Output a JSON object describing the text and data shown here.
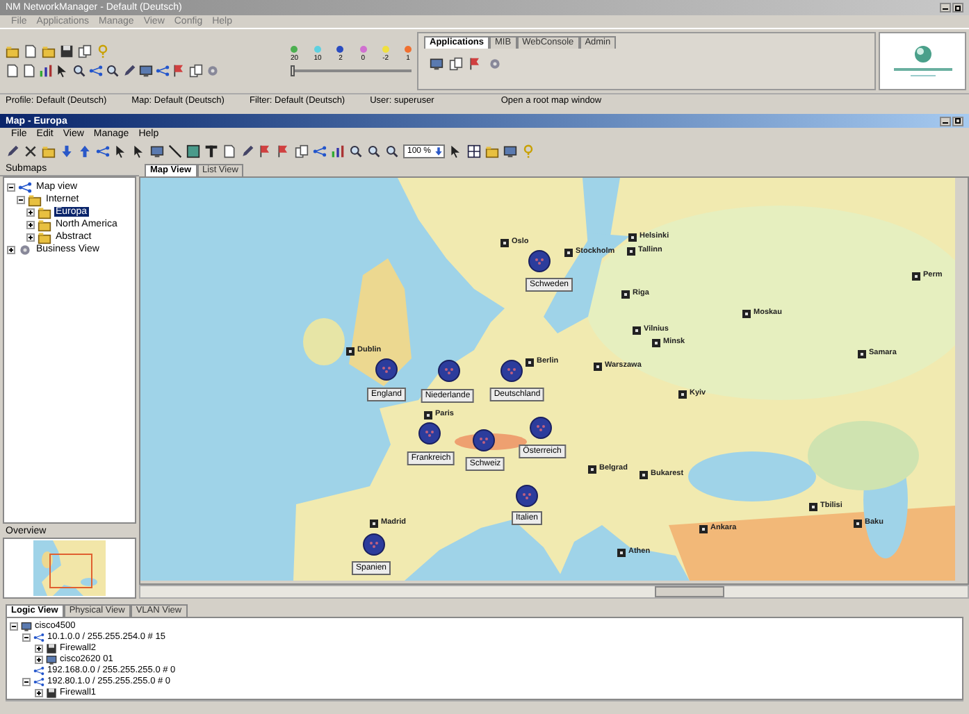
{
  "window": {
    "title": "NM NetworkManager - Default (Deutsch)"
  },
  "menu": [
    "File",
    "Applications",
    "Manage",
    "View",
    "Config",
    "Help"
  ],
  "legend": [
    {
      "color": "#4caf50",
      "label": "20"
    },
    {
      "color": "#5ed0e0",
      "label": "10"
    },
    {
      "color": "#2a4cc0",
      "label": "2"
    },
    {
      "color": "#d070d0",
      "label": "0"
    },
    {
      "color": "#f0e040",
      "label": "-2"
    },
    {
      "color": "#f07030",
      "label": "1"
    }
  ],
  "app_tabs": [
    {
      "label": "Applications",
      "selected": true
    },
    {
      "label": "MIB",
      "selected": false
    },
    {
      "label": "WebConsole",
      "selected": false
    },
    {
      "label": "Admin",
      "selected": false
    }
  ],
  "context": [
    "Profile: Default (Deutsch)",
    "Map: Default (Deutsch)",
    "Filter: Default (Deutsch)",
    "User: superuser",
    "Open a root map window"
  ],
  "map_window": {
    "title": "Map - Europa",
    "menu": [
      "File",
      "Edit",
      "View",
      "Manage",
      "Help"
    ],
    "zoom": "100 %"
  },
  "submaps": {
    "title": "Submaps",
    "tree": [
      {
        "label": "Map view",
        "expanded": true,
        "selected": false,
        "children": [
          {
            "label": "Internet",
            "expanded": true,
            "selected": false,
            "children": [
              {
                "label": "Europa",
                "expanded": false,
                "selected": true
              },
              {
                "label": "North America",
                "expanded": false,
                "selected": false
              },
              {
                "label": "Abstract",
                "expanded": false,
                "selected": false
              }
            ]
          }
        ]
      },
      {
        "label": "Business View",
        "expanded": false,
        "selected": false
      }
    ]
  },
  "overview": {
    "title": "Overview"
  },
  "view_tabs": [
    {
      "label": "Map View",
      "selected": true
    },
    {
      "label": "List View",
      "selected": false
    }
  ],
  "map": {
    "clusters": [
      "Schweden",
      "England",
      "Niederlande",
      "Deutschland",
      "Frankreich",
      "Schweiz",
      "Österreich",
      "Italien",
      "Spanien"
    ],
    "cities": [
      "Oslo",
      "Stockholm",
      "Helsinki",
      "Tallinn",
      "Riga",
      "Vilnius",
      "Minsk",
      "Warszawa",
      "Moskau",
      "Perm",
      "Samara",
      "Kyiv",
      "Bukarest",
      "Belgrad",
      "Ankara",
      "Tbilisi",
      "Baku",
      "Athen",
      "Paris",
      "Dublin",
      "Madrid",
      "Berlin"
    ]
  },
  "bottom_tabs": [
    {
      "label": "Logic View",
      "selected": true
    },
    {
      "label": "Physical View",
      "selected": false
    },
    {
      "label": "VLAN View",
      "selected": false
    }
  ],
  "network_tree": [
    {
      "label": "cisco4500",
      "kind": "router",
      "expanded": true,
      "children": [
        {
          "label": "10.1.0.0 / 255.255.254.0 # 15",
          "kind": "subnet",
          "expanded": true,
          "children": [
            {
              "label": "Firewall2",
              "kind": "firewall",
              "expanded": false
            },
            {
              "label": "cisco2620 01",
              "kind": "router",
              "expanded": false
            }
          ]
        },
        {
          "label": "192.168.0.0 / 255.255.255.0 # 0",
          "kind": "subnet"
        },
        {
          "label": "192.80.1.0 / 255.255.255.0 # 0",
          "kind": "subnet",
          "expanded": true,
          "children": [
            {
              "label": "Firewall1",
              "kind": "firewall",
              "expanded": false
            }
          ]
        }
      ]
    }
  ]
}
